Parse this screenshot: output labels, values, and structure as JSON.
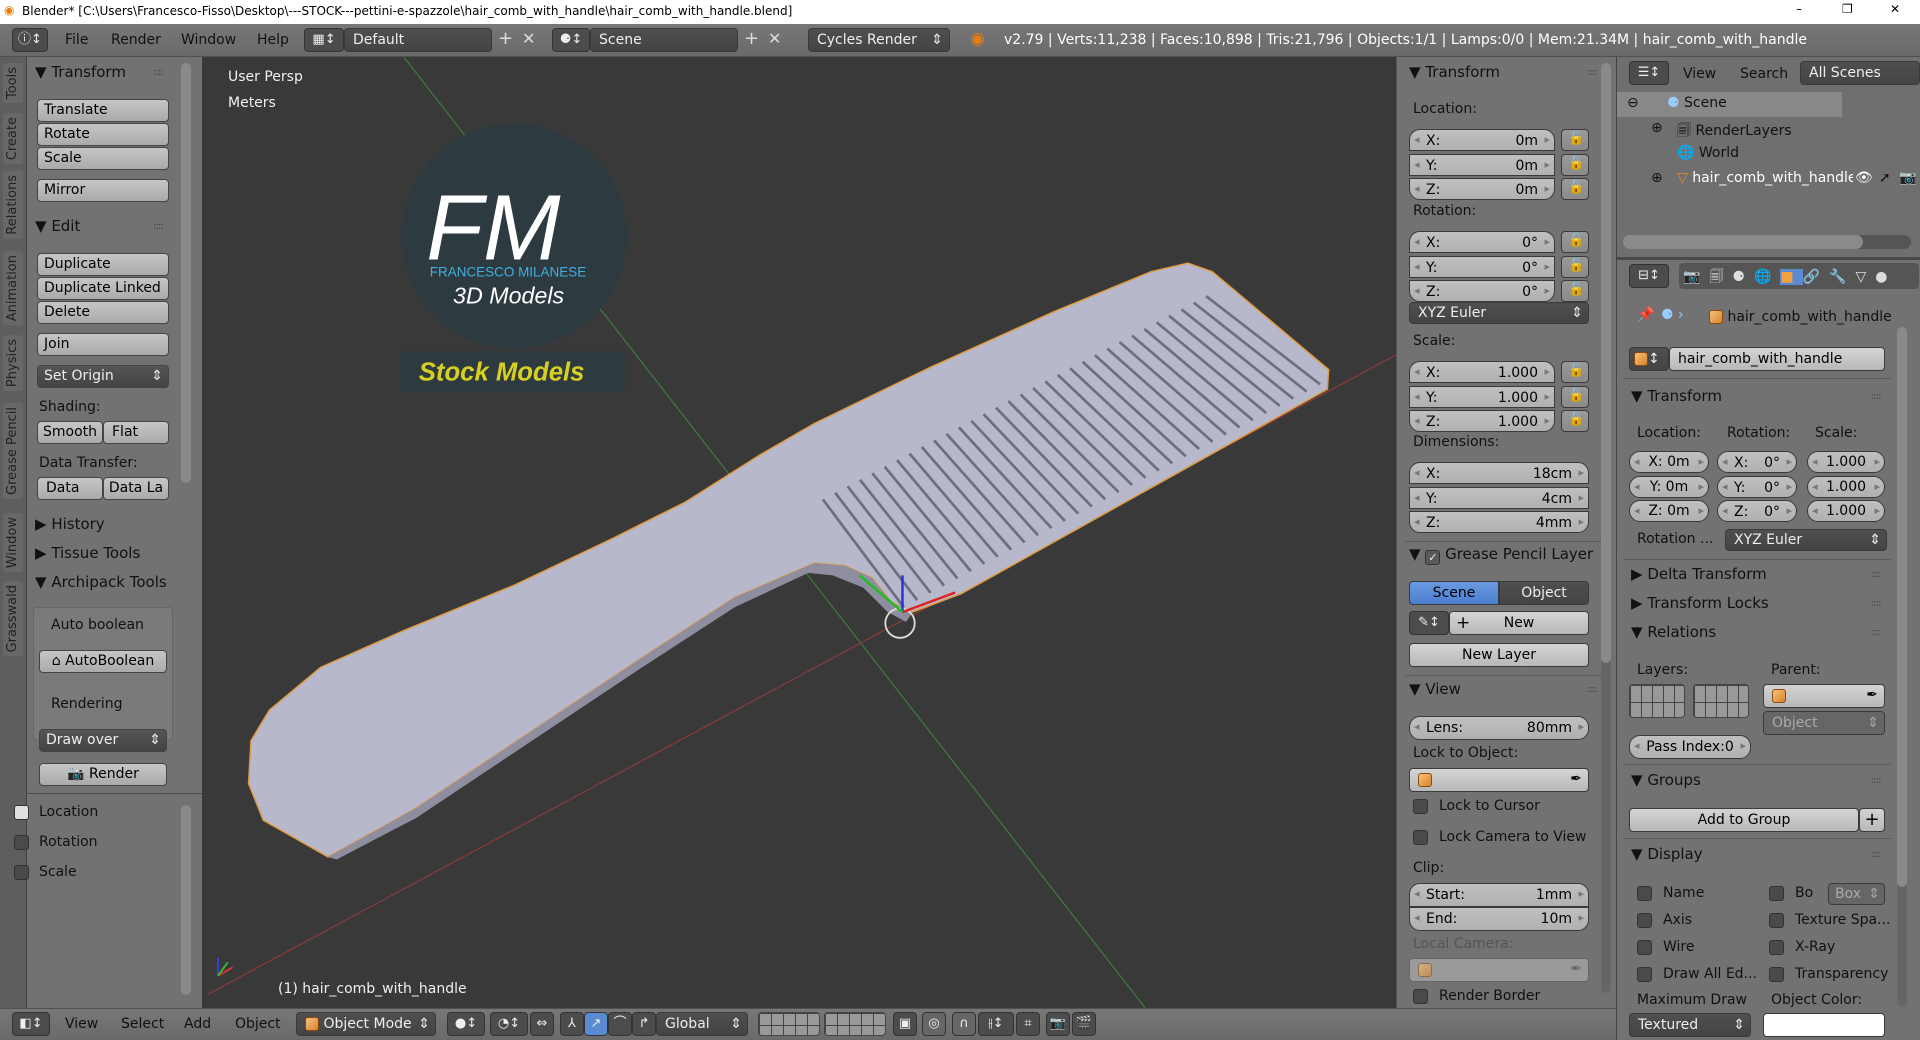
{
  "window": {
    "title": "Blender* [C:\\Users\\Francesco-Fisso\\Desktop\\---STOCK---pettini-e-spazzole\\hair_comb_with_handle\\hair_comb_with_handle.blend]",
    "minimize": "–",
    "maximize": "❐",
    "close": "✕"
  },
  "topbar": {
    "menus": [
      "File",
      "Render",
      "Window",
      "Help"
    ],
    "layout": "Default",
    "scene": "Scene",
    "engine": "Cycles Render",
    "stats": "v2.79 | Verts:11,238 | Faces:10,898 | Tris:21,796 | Objects:1/1 | Lamps:0/0 | Mem:21.34M | hair_comb_with_handle"
  },
  "tabs": [
    "Tools",
    "Create",
    "Relations",
    "Animation",
    "Physics",
    "Grease Pencil",
    "Window",
    "Grasswald"
  ],
  "toolshelf": {
    "transform": {
      "title": "Transform",
      "buttons": [
        "Translate",
        "Rotate",
        "Scale",
        "Mirror"
      ]
    },
    "edit": {
      "title": "Edit",
      "buttons": [
        "Duplicate",
        "Duplicate Linked",
        "Delete",
        "Join"
      ],
      "set_origin": "Set Origin",
      "shading_label": "Shading:",
      "smooth": "Smooth",
      "flat": "Flat",
      "data_transfer_label": "Data Transfer:",
      "data": "Data",
      "data_layout": "Data La"
    },
    "history": "History",
    "tissue": "Tissue Tools",
    "archipack": "Archipack Tools",
    "auto_boolean": "Auto boolean",
    "autoboolean_btn": "AutoBoolean",
    "rendering": "Rendering",
    "draw_over": "Draw over",
    "render": "Render"
  },
  "operator": {
    "location": "Location",
    "rotation": "Rotation",
    "scale": "Scale"
  },
  "viewport": {
    "view_name": "User Persp",
    "units": "Meters",
    "object_label": "(1) hair_comb_with_handle",
    "logo": {
      "initials": "FM",
      "name": "FRANCESCO MILANESE",
      "sub": "3D Models",
      "banner": "Stock Models"
    }
  },
  "npanel": {
    "transform": "Transform",
    "location_label": "Location:",
    "location": [
      {
        "a": "X:",
        "v": "0m"
      },
      {
        "a": "Y:",
        "v": "0m"
      },
      {
        "a": "Z:",
        "v": "0m"
      }
    ],
    "rotation_label": "Rotation:",
    "rotation": [
      {
        "a": "X:",
        "v": "0°"
      },
      {
        "a": "Y:",
        "v": "0°"
      },
      {
        "a": "Z:",
        "v": "0°"
      }
    ],
    "rotation_mode": "XYZ Euler",
    "scale_label": "Scale:",
    "scale": [
      {
        "a": "X:",
        "v": "1.000"
      },
      {
        "a": "Y:",
        "v": "1.000"
      },
      {
        "a": "Z:",
        "v": "1.000"
      }
    ],
    "dimensions_label": "Dimensions:",
    "dimensions": [
      {
        "a": "X:",
        "v": "18cm"
      },
      {
        "a": "Y:",
        "v": "4cm"
      },
      {
        "a": "Z:",
        "v": "4mm"
      }
    ],
    "grease_pencil": "Grease Pencil Layer",
    "gp_scene": "Scene",
    "gp_object": "Object",
    "gp_new": "New",
    "gp_new_layer": "New Layer",
    "view": "View",
    "lens_label": "Lens:",
    "lens": "80mm",
    "lock_object_label": "Lock to Object:",
    "lock_cursor": "Lock to Cursor",
    "lock_camera": "Lock Camera to View",
    "clip_label": "Clip:",
    "clip_start_label": "Start:",
    "clip_start": "1mm",
    "clip_end_label": "End:",
    "clip_end": "10m",
    "local_camera": "Local Camera:",
    "render_border": "Render Border"
  },
  "outliner": {
    "view": "View",
    "search": "Search",
    "filter": "All Scenes",
    "items": [
      "Scene",
      "RenderLayers",
      "World",
      "hair_comb_with_handle"
    ]
  },
  "properties": {
    "breadcrumb": "hair_comb_with_handle",
    "object_name": "hair_comb_with_handle",
    "transform": "Transform",
    "location_label": "Location:",
    "rotation_label": "Rotation:",
    "scale_label": "Scale:",
    "location": [
      "X: 0m",
      "Y: 0m",
      "Z: 0m"
    ],
    "rotation": [
      {
        "a": "X:",
        "v": "0°"
      },
      {
        "a": "Y:",
        "v": "0°"
      },
      {
        "a": "Z:",
        "v": "0°"
      }
    ],
    "scale": [
      "1.000",
      "1.000",
      "1.000"
    ],
    "rotation_mode_label": "Rotation ...",
    "rotation_mode": "XYZ Euler",
    "delta": "Delta Transform",
    "locks": "Transform Locks",
    "relations": "Relations",
    "layers_label": "Layers:",
    "parent_label": "Parent:",
    "parent_type": "Object",
    "pass_index": "Pass Index:0",
    "groups": "Groups",
    "add_to_group": "Add to Group",
    "display": "Display",
    "display_left": [
      "Name",
      "Axis",
      "Wire",
      "Draw All Ed..."
    ],
    "display_right": [
      "Bo",
      "Texture Spa...",
      "X-Ray",
      "Transparency"
    ],
    "bounds_type": "Box",
    "max_draw_label": "Maximum Draw",
    "max_draw": "Textured",
    "object_color_label": "Object Color:",
    "object_color": "#ffffff"
  },
  "bottombar": {
    "menus": [
      "View",
      "Select",
      "Add",
      "Object"
    ],
    "mode": "Object Mode",
    "orientation": "Global"
  }
}
